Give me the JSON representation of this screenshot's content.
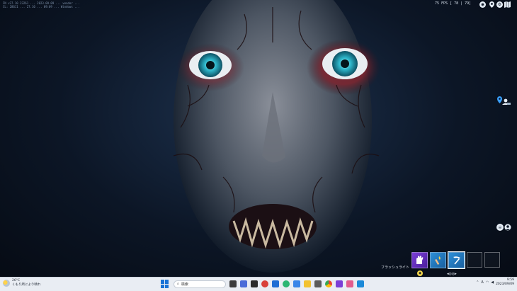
{
  "debug_lines": [
    "FN v27.10  23261 ...  2023.09.09 ...  vendor ...",
    "CL: 28611 ... 27.10 ... 09:09 ... Windows ..."
  ],
  "fps_readout": "75 FPS [ 78 | 79]",
  "hud": {
    "top_icons": [
      "controller-icon",
      "map-pin-icon",
      "settings-icon",
      "map-icon"
    ],
    "player_marker_icon": "location-pin-icon",
    "squad_icon": "squad-icon",
    "emote_icon": "skull-icon"
  },
  "hotbar": {
    "item_name": "フラッシュライト",
    "indicator": "◂◎◎▸",
    "slots": [
      {
        "icon": "glove-icon",
        "color": "purple"
      },
      {
        "icon": "torch-icon",
        "color": "blue"
      },
      {
        "icon": "pickaxe-icon",
        "color": "blue",
        "selected": true
      },
      {
        "icon": "empty"
      },
      {
        "icon": "empty"
      }
    ]
  },
  "taskbar": {
    "weather_temp": "26°C",
    "weather_desc": "くもり所により晴れ",
    "search_label": "検索",
    "tray_lang": "A",
    "time": "9:59",
    "date": "2023/09/09"
  },
  "colors": {
    "background": "#0a1220",
    "slot_purple": "#7b3fd6",
    "slot_blue": "#2c8fd8",
    "taskbar": "#e9edf3",
    "accent": "#1a73d6"
  }
}
